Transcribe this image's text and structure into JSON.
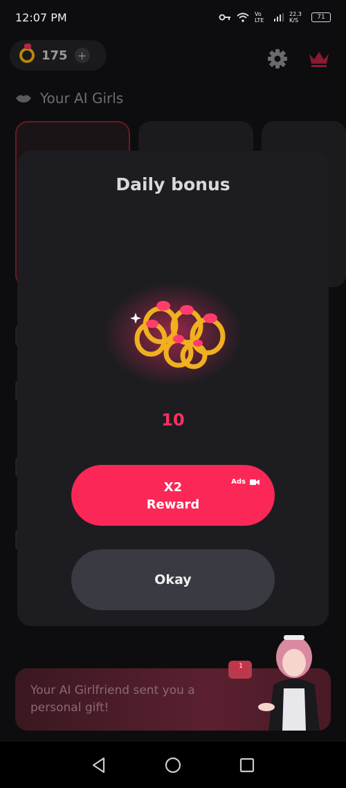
{
  "status_bar": {
    "time": "12:07 PM",
    "network_label": "Vo LTE",
    "speed": "22.3 K/S",
    "battery": "71"
  },
  "header": {
    "coin_count": "175",
    "plus_label": "+"
  },
  "section": {
    "title": "Your AI Girls"
  },
  "gift_banner": {
    "text": "Your AI Girlfriend sent you a personal gift!",
    "badge_count": "1"
  },
  "modal": {
    "title": "Daily bonus",
    "reward_amount": "10",
    "x2_line1": "X2",
    "x2_line2": "Reward",
    "ads_label": "Ads",
    "okay_label": "Okay"
  },
  "colors": {
    "accent": "#fb2757",
    "modal_bg": "#1d1d21",
    "okay_bg": "#3a3b42"
  },
  "icons": [
    "key-icon",
    "wifi-icon",
    "signal-icon",
    "battery-icon",
    "ring-icon",
    "plus-icon",
    "gear-icon",
    "crown-icon",
    "lips-icon",
    "video-icon",
    "back-icon",
    "home-icon",
    "recents-icon"
  ]
}
